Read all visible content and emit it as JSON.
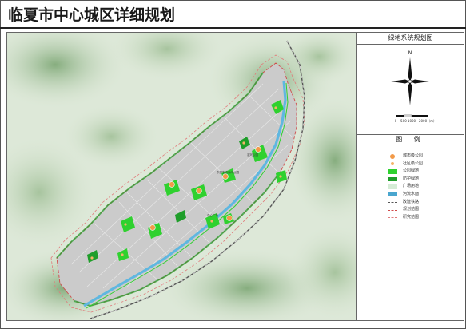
{
  "title": "临夏市中心城区详细规划",
  "map_title": "绿地系统规划图",
  "legend_title": "图 例",
  "compass": {
    "north_label": "N"
  },
  "scale_bar": {
    "ticks": [
      "0",
      "500",
      "1000",
      "2000（m）"
    ]
  },
  "legend": [
    {
      "label": "城市级公园",
      "kind": "dot",
      "color": "#f29a49"
    },
    {
      "label": "社区级公园",
      "kind": "dot-small",
      "color": "#f4b469"
    },
    {
      "label": "公园绿地",
      "kind": "box",
      "color": "#2fd12f"
    },
    {
      "label": "防护绿地",
      "kind": "box",
      "color": "#1f9e2a"
    },
    {
      "label": "广场用地",
      "kind": "box",
      "color": "#d5ecd6"
    },
    {
      "label": "河流水面",
      "kind": "box",
      "color": "#4aa6cf"
    },
    {
      "label": "改建铁路",
      "kind": "rail",
      "color": "#555555"
    },
    {
      "label": "规划范围",
      "kind": "dash",
      "color": "#d04a4a"
    },
    {
      "label": "研究范围",
      "kind": "dash",
      "color": "#e07b7b"
    }
  ],
  "map": {
    "colors": {
      "terrain_light": "#d9e6d3",
      "terrain_dark": "#9fbf96",
      "urban": "#c9c9c9",
      "river": "#5fb7e0",
      "park": "#2fd12f",
      "buffer": "#1f9e2a",
      "boundary": "#d04a4a"
    },
    "labels": [
      "东部生态休闲公园",
      "滨河公园",
      "中心广场"
    ]
  }
}
